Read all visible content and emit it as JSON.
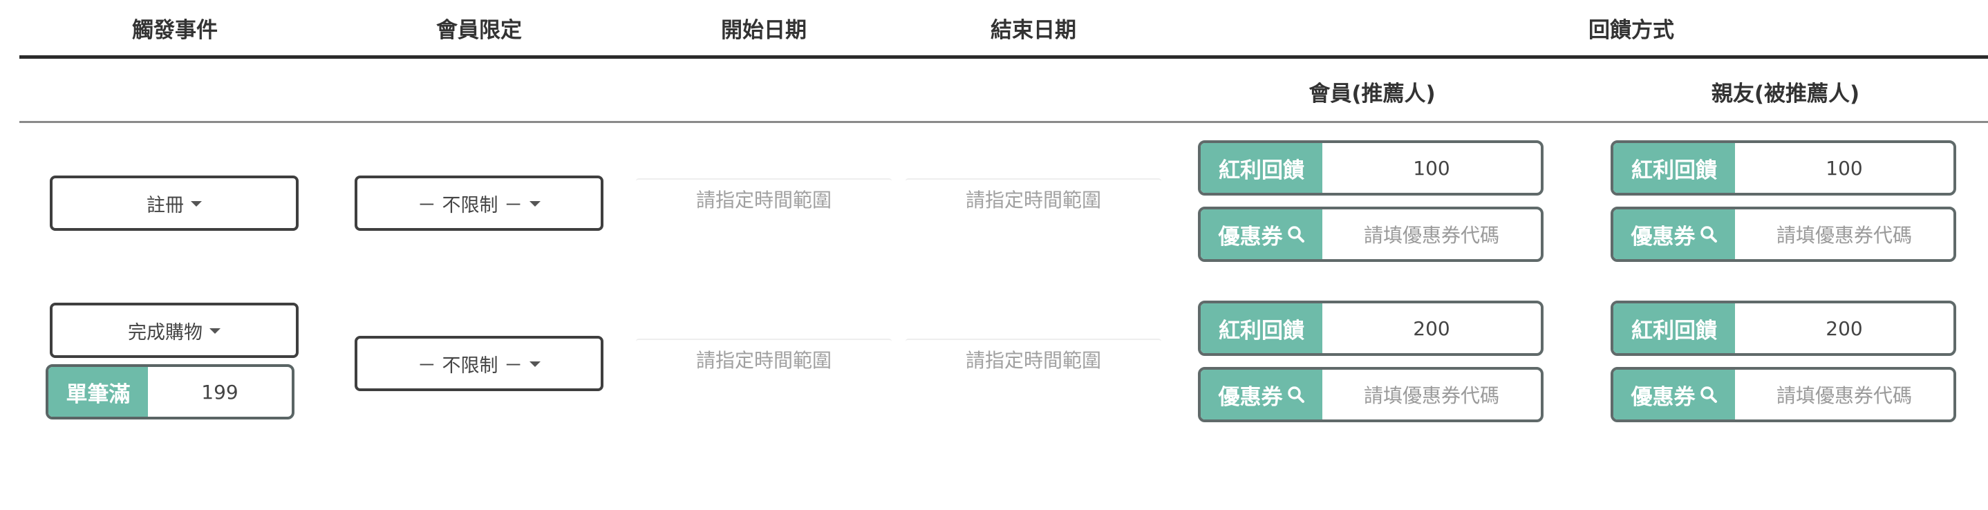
{
  "headers": {
    "trigger_event": "觸發事件",
    "member_limit": "會員限定",
    "start_date": "開始日期",
    "end_date": "結束日期",
    "reward_method": "回饋方式",
    "member_referrer": "會員(推薦人)",
    "friend_referee": "親友(被推薦人)"
  },
  "rows": [
    {
      "trigger": "註冊",
      "member_limit": "－ 不限制 －",
      "start_placeholder": "請指定時間範圍",
      "end_placeholder": "請指定時間範圍",
      "member_bonus_label": "紅利回饋",
      "member_bonus_value": "100",
      "member_coupon_label": "優惠券",
      "member_coupon_placeholder": "請填優惠券代碼",
      "friend_bonus_label": "紅利回饋",
      "friend_bonus_value": "100",
      "friend_coupon_label": "優惠券",
      "friend_coupon_placeholder": "請填優惠券代碼"
    },
    {
      "trigger": "完成購物",
      "min_purchase_label": "單筆滿",
      "min_purchase_value": "199",
      "member_limit": "－ 不限制 －",
      "start_placeholder": "請指定時間範圍",
      "end_placeholder": "請指定時間範圍",
      "member_bonus_label": "紅利回饋",
      "member_bonus_value": "200",
      "member_coupon_label": "優惠券",
      "member_coupon_placeholder": "請填優惠券代碼",
      "friend_bonus_label": "紅利回饋",
      "friend_bonus_value": "200",
      "friend_coupon_label": "優惠券",
      "friend_coupon_placeholder": "請填優惠券代碼"
    }
  ],
  "icons": {
    "dropdown": "caret-down-icon",
    "coupon_search": "search-icon"
  },
  "colors": {
    "accent": "#6ebba9",
    "border": "#606a6a",
    "header_rule": "#2b2b2b"
  }
}
